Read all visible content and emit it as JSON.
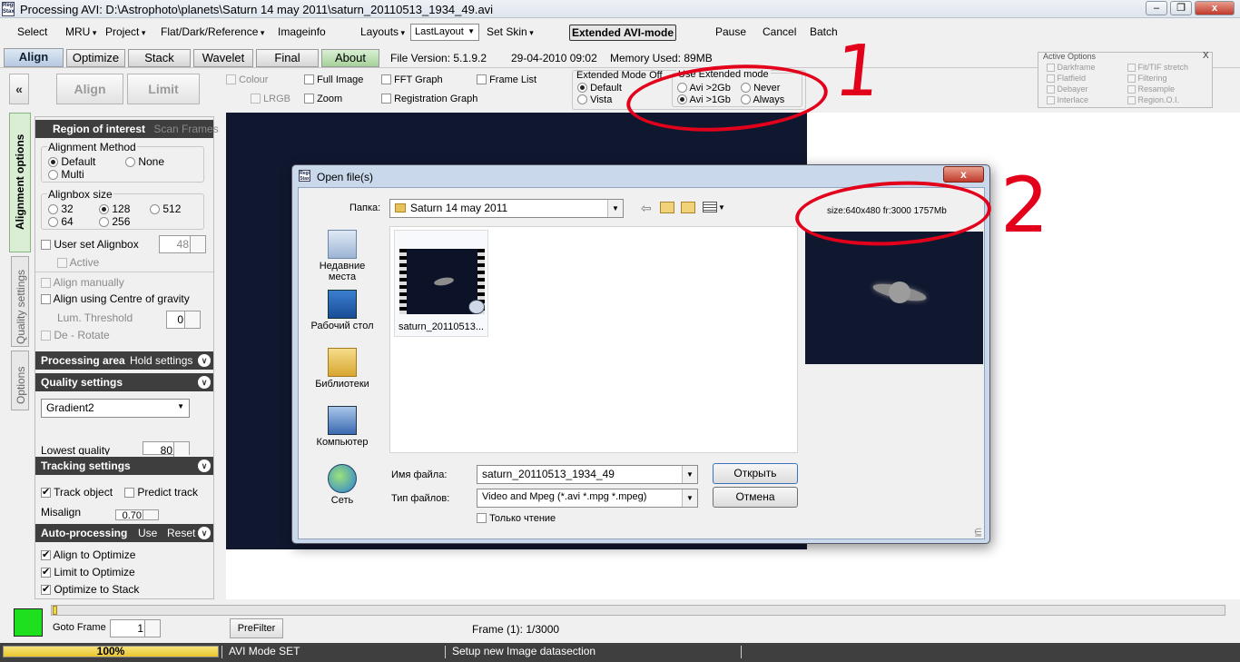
{
  "window": {
    "title": "Processing AVI: D:\\Astrophoto\\planets\\Saturn 14 may 2011\\saturn_20110513_1934_49.avi",
    "icon_text": "Regi Stax"
  },
  "menu": {
    "items": [
      "Select",
      "MRU",
      "Project",
      "Flat/Dark/Reference",
      "Imageinfo",
      "Layouts"
    ],
    "layout_value": "LastLayout",
    "set_skin": "Set Skin",
    "ext_avi": "Extended AVI-mode",
    "pause": "Pause",
    "cancel": "Cancel",
    "batch": "Batch"
  },
  "tabs": [
    "Align",
    "Optimize",
    "Stack",
    "Wavelet",
    "Final",
    "About"
  ],
  "fileinfo": {
    "version": "File Version: 5.1.9.2",
    "date": "29-04-2010 09:02",
    "memory": "Memory Used: 89MB"
  },
  "toolbar": {
    "collapse": "«",
    "align": "Align",
    "limit": "Limit",
    "colour": "Colour",
    "lrgb": "LRGB",
    "full_image": "Full Image",
    "zoom": "Zoom",
    "fft_graph": "FFT Graph",
    "registration_graph": "Registration Graph",
    "frame_list": "Frame List",
    "ext_mode_title": "Extended Mode Off",
    "default": "Default",
    "vista": "Vista",
    "use_ext_title": "Use  Extended mode",
    "avi2gb": "Avi >2Gb",
    "avi1gb": "Avi >1Gb",
    "never": "Never",
    "always": "Always"
  },
  "active_options": {
    "title": "Active Options",
    "close": "X",
    "items": [
      "Darkframe",
      "Flatfield",
      "Debayer",
      "Interlace",
      "Fit/TIF stretch",
      "Filtering",
      "Resample",
      "Region.O.I."
    ]
  },
  "vtabs": [
    "Alignment options",
    "Quality settings",
    "Options"
  ],
  "sidebar": {
    "roi": "Region of interest",
    "scan_frames": "Scan Frames",
    "align_method": "Alignment Method",
    "default": "Default",
    "none": "None",
    "multi": "Multi",
    "alignbox_size": "Alignbox size",
    "s32": "32",
    "s128": "128",
    "s512": "512",
    "s64": "64",
    "s256": "256",
    "user_set": "User set Alignbox",
    "user_set_val": "48",
    "active": "Active",
    "align_manually": "Align manually",
    "align_cog": "Align using Centre of gravity",
    "lum_threshold": "Lum. Threshold",
    "lum_val": "0",
    "derotate": "De - Rotate",
    "processing_area": "Processing area",
    "hold_settings": "Hold settings",
    "quality_settings": "Quality settings",
    "quality_method": "Gradient2",
    "lowest_quality": "Lowest quality",
    "lowest_val": "80",
    "tracking": "Tracking settings",
    "track_object": "Track object",
    "predict_track": "Predict track",
    "misalign": "Misalign",
    "misalign_val": "0.70",
    "autoproc": "Auto-processing",
    "use": "Use",
    "reset": "Reset",
    "align_opt": "Align to Optimize",
    "limit_opt": "Limit to Optimize",
    "opt_stack": "Optimize to Stack"
  },
  "bottom": {
    "goto": "Goto Frame",
    "goto_val": "1",
    "prefilter": "PreFilter",
    "frame": "Frame (1): 1/3000"
  },
  "status": {
    "progress": "100%",
    "progress_fraction": 1.0,
    "mode": "AVI Mode SET",
    "msg": "Setup new Image datasection"
  },
  "dialog": {
    "title": "Open file(s)",
    "close": "x",
    "folder_label": "Папка:",
    "folder": "Saturn 14 may 2011",
    "places": [
      "Недавние места",
      "Рабочий стол",
      "Библиотеки",
      "Компьютер",
      "Сеть"
    ],
    "file_item": "saturn_20110513...",
    "info": "size:640x480 fr:3000  1757Mb",
    "filename_label": "Имя файла:",
    "filename": "saturn_20110513_1934_49",
    "filetype_label": "Тип файлов:",
    "filetype": "Video and Mpeg (*.avi *.mpg *.mpeg)",
    "readonly": "Только чтение",
    "open": "Открыть",
    "cancel": "Отмена"
  },
  "annotations": {
    "one": "1",
    "two": "2"
  },
  "colors": {
    "annotation": "#e3001b",
    "preview_bg": "#101830",
    "status_green": "#1fe01f"
  }
}
